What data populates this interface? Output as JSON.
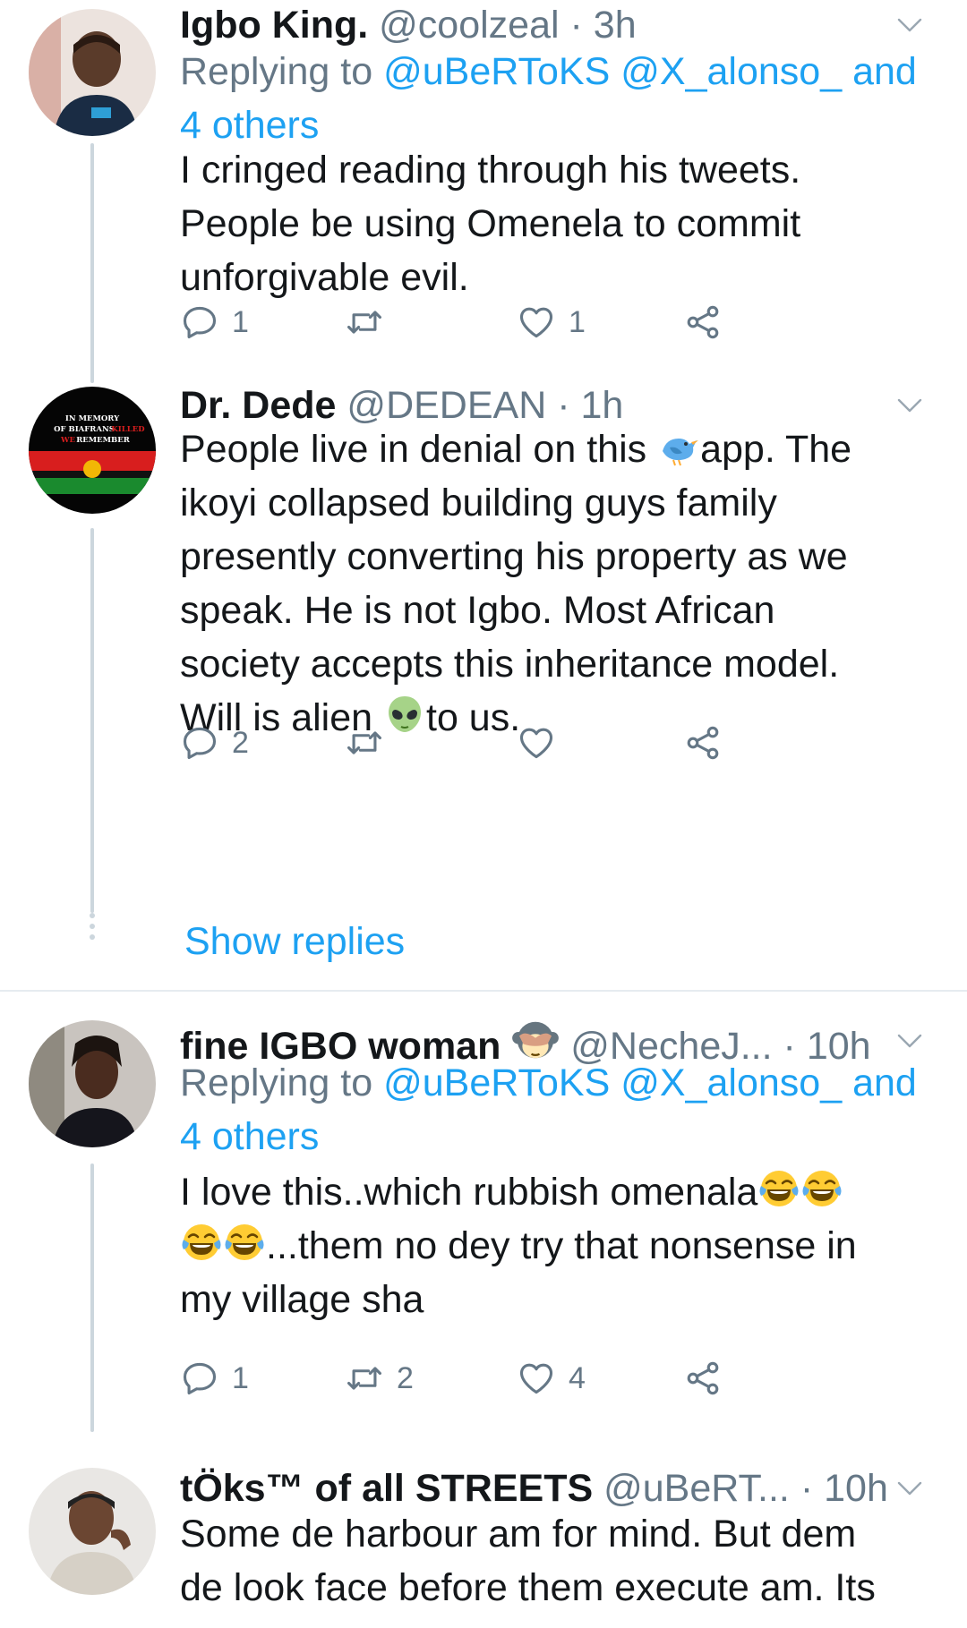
{
  "tweets": [
    {
      "name": "Igbo King.",
      "handle": "@coolzeal",
      "dot": "·",
      "time": "3h",
      "replying_label": "Replying to ",
      "mention1": "@uBeRToKS",
      "mention2": "@X_alonso_",
      "and_label": " and",
      "others_label": "4 others",
      "lines": [
        "I cringed reading through his tweets.",
        "People be using Omenela to commit",
        "unforgivable evil."
      ],
      "reply_count": "1",
      "retweet_count": "",
      "like_count": "1"
    },
    {
      "name": "Dr. Dede",
      "handle": "@DEDEAN",
      "dot": "·",
      "time": "1h",
      "line1a": "People live in denial on this ",
      "line1b": "app. The",
      "lines": [
        "ikoyi collapsed building guys family",
        "presently converting his property as we",
        "speak.  He is not Igbo. Most African",
        "society accepts this inheritance model."
      ],
      "line6a": "Will is alien ",
      "line6b": "to us.",
      "reply_count": "2",
      "retweet_count": "",
      "like_count": "",
      "show_replies": "Show replies",
      "avatar_text": [
        "IN MEMORY",
        "OF BIAFRANS ",
        "KILLED",
        "WE ",
        "REMEMBER"
      ]
    },
    {
      "name": "fine IGBO woman",
      "handle": "@NecheJ...",
      "dot": "·",
      "time": "10h",
      "replying_label": "Replying to ",
      "mention1": "@uBeRToKS",
      "mention2": "@X_alonso_",
      "and_label": " and",
      "others_label": "4 others",
      "line1": "I love this..which rubbish omenala",
      "line2": "...them no dey try that nonsense in",
      "line3": "my village sha",
      "reply_count": "1",
      "retweet_count": "2",
      "like_count": "4"
    },
    {
      "name": "tÖks™ of all STREETS",
      "handle": "@uBeRT...",
      "dot": "·",
      "time": "10h",
      "lines": [
        "Some de harbour am for mind. But dem",
        "de look face before them execute am. Its"
      ]
    }
  ],
  "icons": {
    "reply": "reply-icon",
    "retweet": "retweet-icon",
    "like": "heart-icon",
    "share": "share-icon",
    "chevron": "chevron-down-icon"
  },
  "colors": {
    "accent": "#1da1f2",
    "secondary_text": "#657786",
    "thread_line": "#ccd6dd",
    "divider": "#e6ecf0"
  }
}
